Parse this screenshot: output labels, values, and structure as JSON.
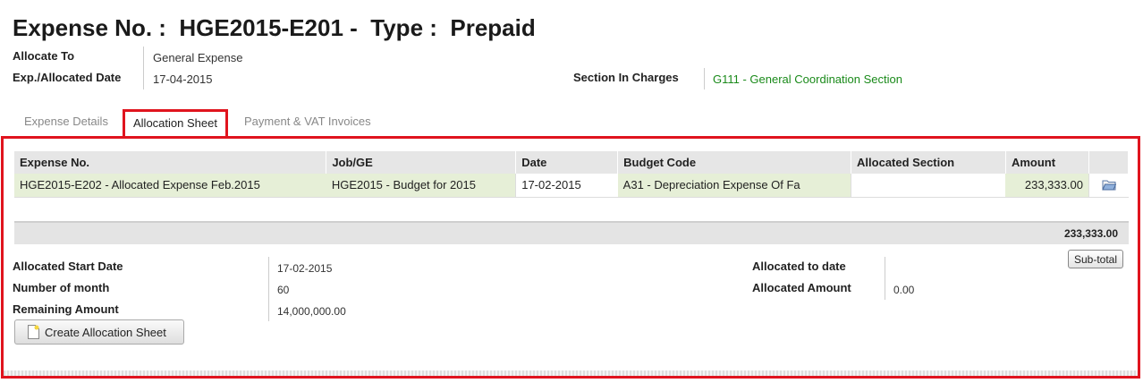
{
  "header": {
    "title": "Expense No. :  HGE2015-E201 -  Type :  Prepaid",
    "allocate_to_label": "Allocate To",
    "allocate_to_value": "General Expense",
    "date_label": "Exp./Allocated Date",
    "date_value": "17-04-2015",
    "section_label": "Section In Charges",
    "section_value": "G111 - General Coordination Section"
  },
  "tabs": [
    {
      "label": "Expense Details",
      "active": false
    },
    {
      "label": "Allocation Sheet",
      "active": true
    },
    {
      "label": "Payment & VAT Invoices",
      "active": false
    }
  ],
  "table": {
    "columns": [
      "Expense No.",
      "Job/GE",
      "Date",
      "Budget Code",
      "Allocated Section",
      "Amount"
    ],
    "rows": [
      {
        "expense_no": "HGE2015-E202 - Allocated Expense Feb.2015",
        "job_ge": "HGE2015 - Budget for 2015",
        "date": "17-02-2015",
        "budget_code": "A31 - Depreciation Expense Of Fa",
        "allocated_section": "",
        "amount": "233,333.00",
        "action_icon": "folder-open-icon"
      }
    ],
    "total": "233,333.00"
  },
  "subtotal_button": "Sub-total",
  "summary": {
    "start_date_label": "Allocated Start Date",
    "start_date_value": "17-02-2015",
    "months_label": "Number of month",
    "months_value": "60",
    "remaining_label": "Remaining Amount",
    "remaining_value": "14,000,000.00",
    "allocated_to_date_label": "Allocated to date",
    "allocated_to_date_value": "",
    "allocated_amount_label": "Allocated Amount",
    "allocated_amount_value": "0.00"
  },
  "create_button": {
    "label": "Create Allocation Sheet",
    "icon": "new-document-icon"
  },
  "colors": {
    "highlight": "#e0141e",
    "link_green": "#1a8a1a",
    "row_green": "#e6efd7"
  }
}
